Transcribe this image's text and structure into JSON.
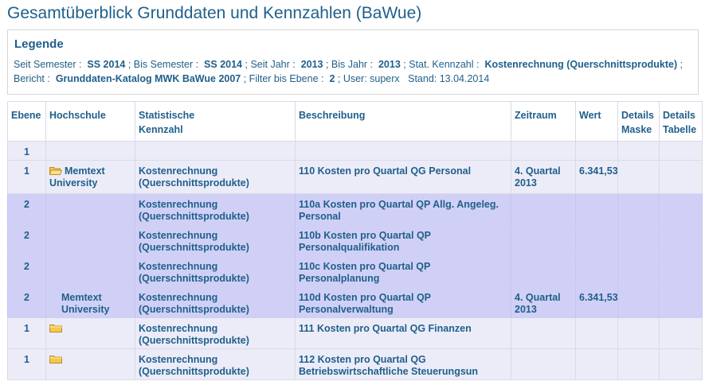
{
  "title": "Gesamtüberblick Grunddaten und Kennzahlen (BaWue)",
  "legend": {
    "heading": "Legende",
    "seit_semester_label": "Seit Semester :",
    "seit_semester": "SS 2014",
    "bis_semester_label": "; Bis Semester :",
    "bis_semester": "SS 2014",
    "seit_jahr_label": "; Seit Jahr :",
    "seit_jahr": "2013",
    "bis_jahr_label": "; Bis Jahr :",
    "bis_jahr": "2013",
    "kennzahl_label": "; Stat. Kennzahl :",
    "kennzahl": "Kostenrechnung (Querschnittsprodukte)",
    "bericht_label": "; Bericht :",
    "bericht": "Grunddaten-Katalog MWK BaWue 2007",
    "ebene_label": "; Filter bis Ebene :",
    "ebene": "2",
    "user": "; User: superx",
    "stand": "Stand: 13.04.2014"
  },
  "table": {
    "headers": {
      "ebene": "Ebene",
      "hochschule": "Hochschule",
      "kennzahl_1": "Statistische",
      "kennzahl_2": "Kennzahl",
      "beschreibung": "Beschreibung",
      "zeitraum": "Zeitraum",
      "wert": "Wert",
      "maske_1": "Details",
      "maske_2": "Maske",
      "tabelle_1": "Details",
      "tabelle_2": "Tabelle"
    },
    "rows": [
      {
        "ebene": "1",
        "hochschule": "",
        "kennzahl": "",
        "beschreibung": "",
        "zeitraum": "",
        "wert": ""
      },
      {
        "ebene": "1",
        "hochschule": "Memtext University",
        "kennzahl": "Kostenrechnung (Querschnittsprodukte)",
        "beschreibung": "110 Kosten pro Quartal QG Personal",
        "zeitraum": "4. Quartal 2013",
        "wert": "6.341,53"
      },
      {
        "ebene": "2",
        "hochschule": "",
        "kennzahl": "Kostenrechnung (Querschnittsprodukte)",
        "beschreibung": "110a Kosten pro Quartal QP Allg. Angeleg. Personal",
        "zeitraum": "",
        "wert": ""
      },
      {
        "ebene": "2",
        "hochschule": "",
        "kennzahl": "Kostenrechnung (Querschnittsprodukte)",
        "beschreibung": "110b Kosten pro Quartal QP Personalqualifikation",
        "zeitraum": "",
        "wert": ""
      },
      {
        "ebene": "2",
        "hochschule": "",
        "kennzahl": "Kostenrechnung (Querschnittsprodukte)",
        "beschreibung": "110c Kosten pro Quartal QP Personalplanung",
        "zeitraum": "",
        "wert": ""
      },
      {
        "ebene": "2",
        "hochschule": "Memtext University",
        "kennzahl": "Kostenrechnung (Querschnittsprodukte)",
        "beschreibung": "110d Kosten pro Quartal QP Personalverwaltung",
        "zeitraum": "4. Quartal 2013",
        "wert": "6.341,53"
      },
      {
        "ebene": "1",
        "hochschule": "",
        "kennzahl": "Kostenrechnung (Querschnittsprodukte)",
        "beschreibung": "111 Kosten pro Quartal QG Finanzen",
        "zeitraum": "",
        "wert": ""
      },
      {
        "ebene": "1",
        "hochschule": "",
        "kennzahl": "Kostenrechnung (Querschnittsprodukte)",
        "beschreibung": "112 Kosten pro Quartal QG Betriebswirtschaftliche Steuerungsun",
        "zeitraum": "",
        "wert": ""
      }
    ]
  },
  "icons": {
    "folder_open": "folder-open-icon",
    "folder": "folder-icon"
  },
  "colors": {
    "text": "#1f5f8b",
    "row_light": "#ececf8",
    "row_dark": "#d0d0f6",
    "folder": "#f5c84a"
  }
}
